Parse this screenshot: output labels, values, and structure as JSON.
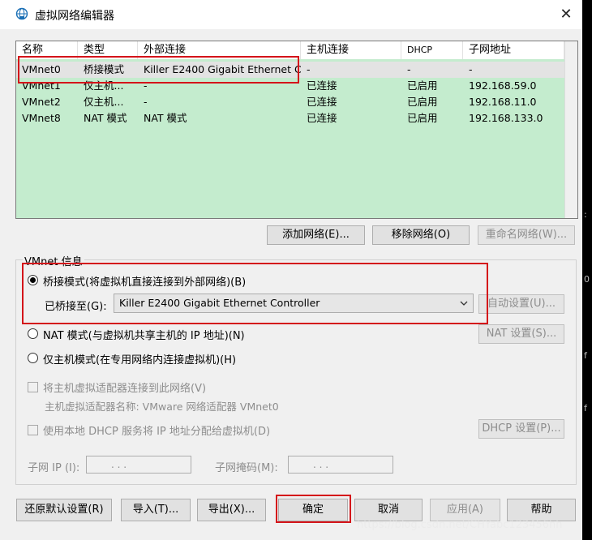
{
  "window": {
    "title": "虚拟网络编辑器",
    "close": "✕"
  },
  "table": {
    "headers": [
      "名称",
      "类型",
      "外部连接",
      "主机连接",
      "DHCP",
      "子网地址"
    ],
    "rows": [
      [
        "VMnet0",
        "桥接模式",
        "Killer E2400 Gigabit Ethernet C...",
        "-",
        "-",
        "-"
      ],
      [
        "VMnet1",
        "仅主机...",
        "-",
        "已连接",
        "已启用",
        "192.168.59.0"
      ],
      [
        "VMnet2",
        "仅主机...",
        "-",
        "已连接",
        "已启用",
        "192.168.11.0"
      ],
      [
        "VMnet8",
        "NAT 模式",
        "NAT 模式",
        "已连接",
        "已启用",
        "192.168.133.0"
      ]
    ]
  },
  "table_buttons": {
    "add": "添加网络(E)...",
    "remove": "移除网络(O)",
    "rename": "重命名网络(W)..."
  },
  "vmnet_info": {
    "title": "VMnet 信息",
    "bridged": "桥接模式(将虚拟机直接连接到外部网络)(B)",
    "bridged_to_label": "已桥接至(G):",
    "bridged_to_value": "Killer E2400 Gigabit Ethernet Controller",
    "auto_settings": "自动设置(U)...",
    "nat": "NAT 模式(与虚拟机共享主机的 IP 地址)(N)",
    "nat_settings": "NAT 设置(S)...",
    "hostonly": "仅主机模式(在专用网络内连接虚拟机)(H)",
    "connect_adapter": "将主机虚拟适配器连接到此网络(V)",
    "adapter_name": "主机虚拟适配器名称: VMware 网络适配器 VMnet0",
    "use_dhcp": "使用本地 DHCP 服务将 IP 地址分配给虚拟机(D)",
    "dhcp_settings": "DHCP 设置(P)...",
    "subnet_ip_label": "子网 IP (I):",
    "subnet_ip_value": ".     .     .",
    "subnet_mask_label": "子网掩码(M):",
    "subnet_mask_value": ".     .     ."
  },
  "footer": {
    "restore": "还原默认设置(R)",
    "import": "导入(T)...",
    "export": "导出(X)...",
    "ok": "确定",
    "cancel": "取消",
    "apply": "应用(A)",
    "help": "帮助"
  },
  "watermark": "https://blog.csdn.net/CHYabc123456hh",
  "edge_chars": [
    ":",
    "0",
    "f",
    "f"
  ],
  "colors": {
    "table_bg": "#c4ecce",
    "highlight": "#d4141a"
  }
}
